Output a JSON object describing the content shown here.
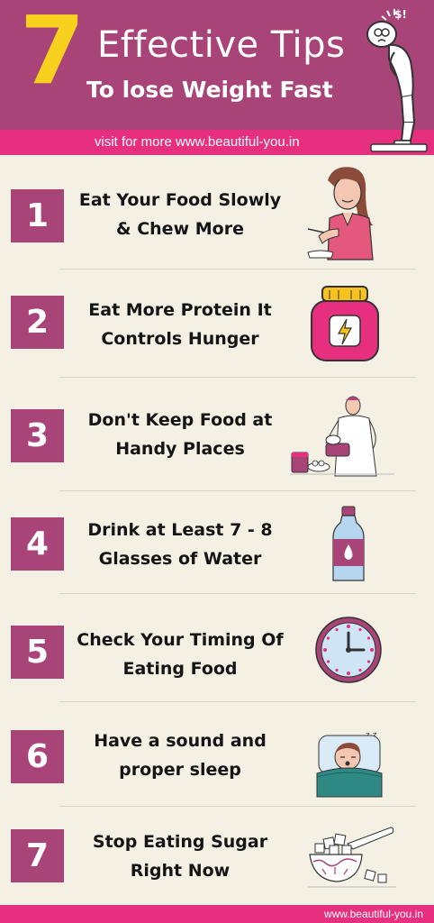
{
  "header": {
    "number": "7",
    "title_line1": "Effective Tips",
    "title_line2": "To lose Weight Fast",
    "visit_text": "visit  for more www.beautiful-you.in",
    "exclaim_text": "$!"
  },
  "tips": [
    {
      "num": "1",
      "line1": "Eat Your Food Slowly",
      "line2": "& Chew More",
      "icon": "woman-eating-icon"
    },
    {
      "num": "2",
      "line1": "Eat More Protein It",
      "line2": "Controls Hunger",
      "icon": "protein-jar-icon"
    },
    {
      "num": "3",
      "line1": "Don't Keep Food at",
      "line2": "Handy Places",
      "icon": "man-with-food-icon"
    },
    {
      "num": "4",
      "line1": "Drink at Least 7 - 8",
      "line2": "Glasses of Water",
      "icon": "water-bottle-icon"
    },
    {
      "num": "5",
      "line1": "Check Your Timing Of",
      "line2": "Eating Food",
      "icon": "clock-icon"
    },
    {
      "num": "6",
      "line1": "Have a sound and",
      "line2": "proper sleep",
      "icon": "sleeping-person-icon"
    },
    {
      "num": "7",
      "line1": "Stop Eating Sugar",
      "line2": "Right Now",
      "icon": "sugar-bowl-icon"
    }
  ],
  "footer": {
    "url": "www.beautiful-you.in"
  },
  "colors": {
    "primary": "#a84478",
    "accent": "#e6307f",
    "yellow": "#f7d11e",
    "background": "#f4f1e4"
  }
}
